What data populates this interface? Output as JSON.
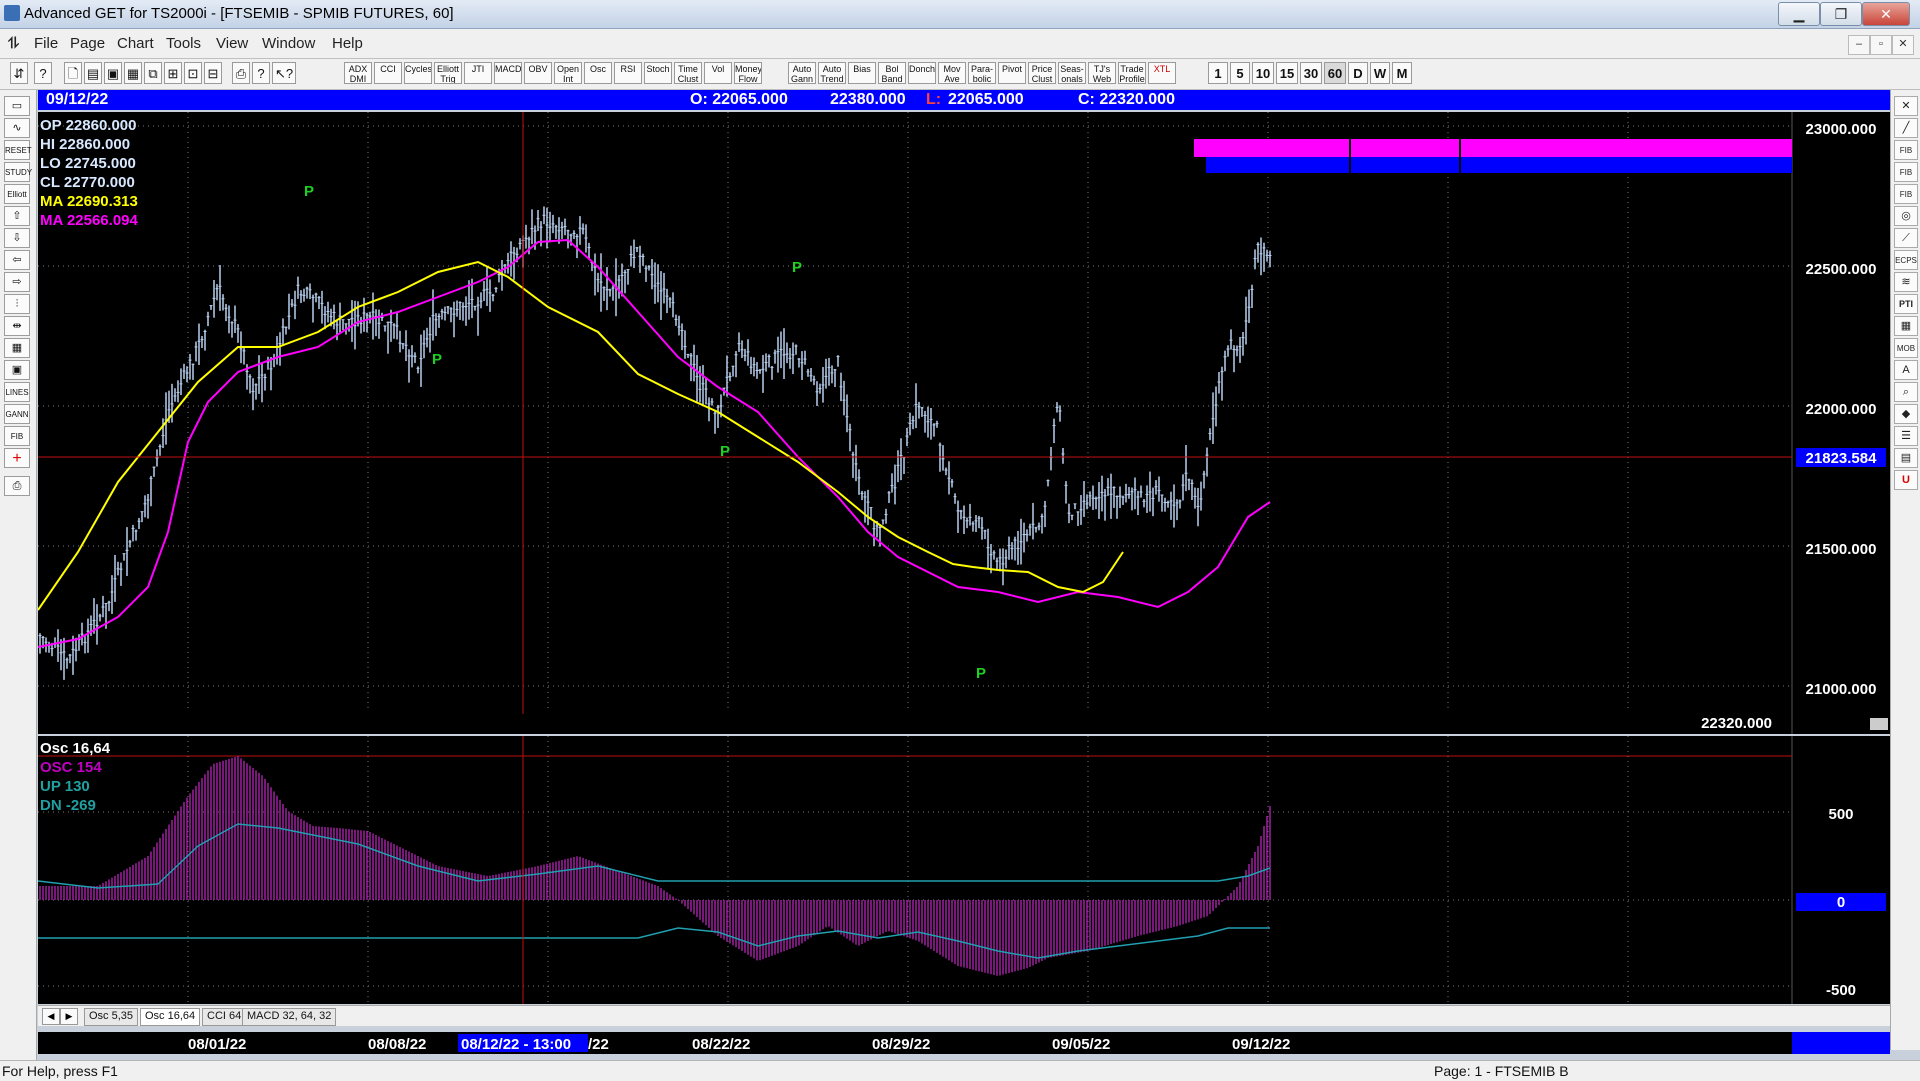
{
  "window": {
    "title": "Advanced GET for TS2000i - [FTSEMIB - SPMIB FUTURES, 60]"
  },
  "menu": [
    "File",
    "Page",
    "Chart",
    "Tools",
    "View",
    "Window",
    "Help"
  ],
  "toolbar": {
    "studies": [
      "ADX DMI",
      "CCI",
      "Cycles",
      "Elliott Trig",
      "JTI",
      "MACD",
      "OBV",
      "Open Int",
      "Osc",
      "RSI",
      "Stoch",
      "Time Clust",
      "Vol",
      "Money Flow",
      "Auto Gann",
      "Auto Trend",
      "Bias",
      "Bol Band",
      "Donch",
      "Mov Ave",
      "Para-bolic",
      "Pivot",
      "Price Clust",
      "Seas-onals",
      "TJ's Web",
      "Trade Profile",
      "XTL"
    ],
    "periods": [
      "1",
      "5",
      "10",
      "15",
      "30",
      "60",
      "D",
      "W",
      "M"
    ]
  },
  "infobar": {
    "date": "09/12/22",
    "open": "O: 22065.000",
    "high": "22380.000",
    "low_prefix": "L:",
    "low": "22065.000",
    "close": "C: 22320.000"
  },
  "price_legend": [
    {
      "label": "OP 22860.000",
      "color": "#d8e8ff"
    },
    {
      "label": "HI 22860.000",
      "color": "#d8e8ff"
    },
    {
      "label": "LO 22745.000",
      "color": "#d8e8ff"
    },
    {
      "label": "CL 22770.000",
      "color": "#d8e8ff"
    },
    {
      "label": "MA 22690.313",
      "color": "#ffff00"
    },
    {
      "label": "MA 22566.094",
      "color": "#ff00ff"
    }
  ],
  "osc_legend": {
    "title": "Osc 16,64",
    "items": [
      {
        "label": "OSC 154",
        "color": "#c000c0"
      },
      {
        "label": "UP   130",
        "color": "#20a0a0"
      },
      {
        "label": "DN   -269",
        "color": "#20a0a0"
      }
    ]
  },
  "price_axis": {
    "ticks": [
      "23000.000",
      "22500.000",
      "22000.000",
      "21500.000",
      "21000.000"
    ],
    "crosshair_label": "21823.584",
    "last_label": "22320.000"
  },
  "osc_axis": {
    "ticks": [
      "500",
      "0",
      "-500"
    ]
  },
  "date_axis": {
    "labels": [
      "08/01/22",
      "08/08/22",
      "08/22/22",
      "08/29/22",
      "09/05/22",
      "09/12/22"
    ],
    "cursor_label": "08/12/22 - 13:00",
    "cursor_tail": "/22"
  },
  "pivot_label": "P",
  "tabs": [
    "Osc 5,35",
    "Osc 16,64",
    "CCI 64",
    "MACD 32, 64, 32"
  ],
  "status": {
    "left": "For Help, press F1",
    "right": "Page: 1 - FTSEMIB B"
  },
  "colors": {
    "bg": "#000000",
    "bars": "#b8d0f0",
    "ma_fast": "#ffff00",
    "ma_slow": "#ff00ff",
    "crosshair": "#c01010",
    "osc": "#c020c0",
    "osc_lines": "#20a0b0",
    "pivot": "#20d020",
    "axis_blue": "#0000ff"
  },
  "chart_data": {
    "type": "ohlc",
    "crosshair": {
      "price": 21823.584,
      "date": "08/12/22 - 13:00"
    },
    "ylim": [
      20900,
      23100
    ],
    "y_ticks": [
      21000,
      21500,
      22000,
      22500,
      23000
    ]
  }
}
